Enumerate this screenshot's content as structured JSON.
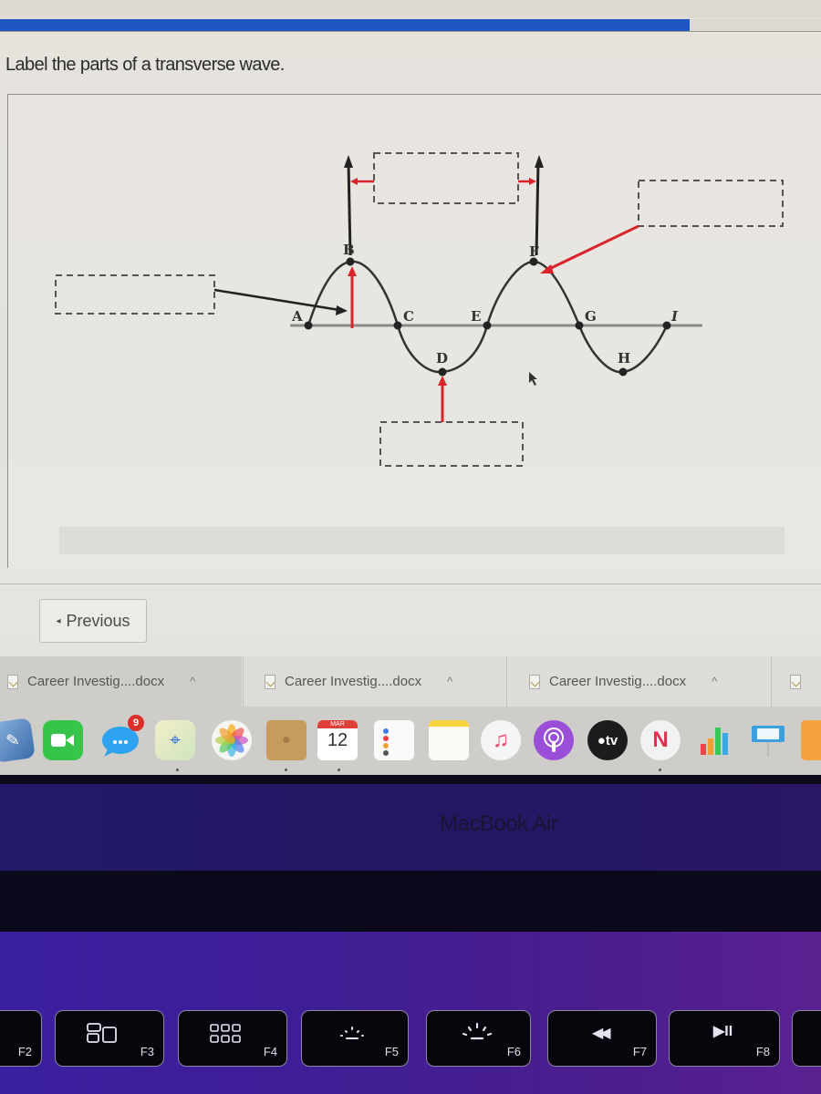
{
  "progress": {
    "fraction_complete": 0.84,
    "color": "#1f55c0"
  },
  "question": {
    "text": "Label the parts of a transverse wave."
  },
  "diagram": {
    "point_labels": [
      "A",
      "B",
      "C",
      "D",
      "E",
      "F",
      "G",
      "H",
      "I"
    ],
    "answer_boxes": [
      {
        "id": "box-left",
        "value": "",
        "points_to": "A-B"
      },
      {
        "id": "box-top-center",
        "value": "",
        "points_to": "B-F"
      },
      {
        "id": "box-top-right",
        "value": "",
        "points_to": "F"
      },
      {
        "id": "box-bottom",
        "value": "",
        "points_to": "D"
      }
    ],
    "colors": {
      "wave": "#333333",
      "axis": "#8a8a86",
      "pointer": "#d9242b",
      "box_border": "#555555"
    }
  },
  "nav": {
    "previous_label": "Previous",
    "previous_icon": "◂"
  },
  "downloads": {
    "items": [
      {
        "filename": "Career Investig....docx",
        "caret": "^"
      },
      {
        "filename": "Career Investig....docx",
        "caret": "^"
      },
      {
        "filename": "Career Investig....docx",
        "caret": "^"
      }
    ]
  },
  "dock": {
    "apps": [
      {
        "name": "Preview"
      },
      {
        "name": "FaceTime"
      },
      {
        "name": "Messages",
        "badge": "9"
      },
      {
        "name": "Maps"
      },
      {
        "name": "Photos"
      },
      {
        "name": "Contacts"
      },
      {
        "name": "Calendar",
        "month": "MAR",
        "day": "12"
      },
      {
        "name": "Reminders"
      },
      {
        "name": "Notes"
      },
      {
        "name": "Music"
      },
      {
        "name": "Podcasts"
      },
      {
        "name": "TV",
        "label": "tv"
      },
      {
        "name": "News"
      },
      {
        "name": "Numbers"
      },
      {
        "name": "Keynote"
      },
      {
        "name": "Pages"
      }
    ]
  },
  "laptop": {
    "brand": "MacBook Air"
  },
  "keyboard": {
    "keys": [
      {
        "label": "F2"
      },
      {
        "label": "F3"
      },
      {
        "label": "F4"
      },
      {
        "label": "F5"
      },
      {
        "label": "F6"
      },
      {
        "label": "F7",
        "glyph": "◀◀"
      },
      {
        "label": "F8",
        "glyph": "▶II"
      }
    ]
  }
}
